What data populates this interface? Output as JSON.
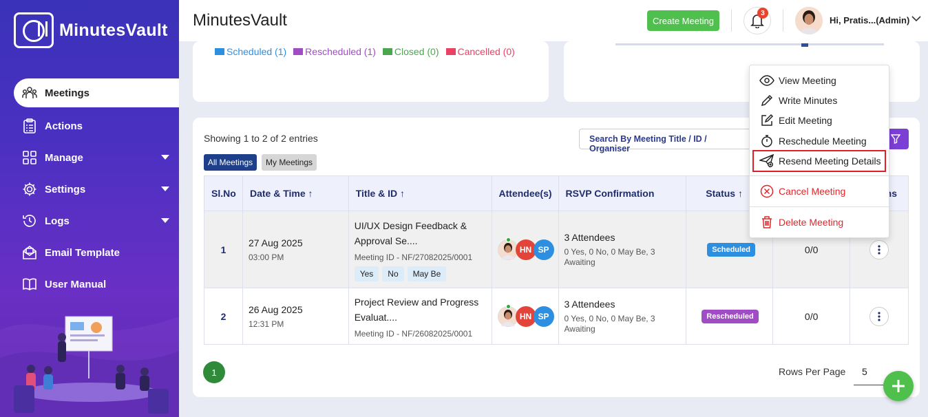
{
  "app": {
    "name": "MinutesVault"
  },
  "sidebar": {
    "items": [
      {
        "label": "Meetings",
        "icon": "meetings-icon",
        "active": true
      },
      {
        "label": "Actions",
        "icon": "clipboard-icon"
      },
      {
        "label": "Manage",
        "icon": "grid-icon",
        "caret": true
      },
      {
        "label": "Settings",
        "icon": "gear-icon",
        "caret": true
      },
      {
        "label": "Logs",
        "icon": "history-icon",
        "caret": true
      },
      {
        "label": "Email Template",
        "icon": "email-icon"
      },
      {
        "label": "User Manual",
        "icon": "book-icon"
      }
    ]
  },
  "header": {
    "title": "MinutesVault",
    "create_label": "Create Meeting",
    "notification_count": "3",
    "user_label": "Hi, Pratis...(Admin)"
  },
  "legend": [
    {
      "label": "Scheduled (1)",
      "color": "#2e8fe0"
    },
    {
      "label": "Rescheduled (1)",
      "color": "#a04cc4"
    },
    {
      "label": "Closed (0)",
      "color": "#4ca650"
    },
    {
      "label": "Cancelled (0)",
      "color": "#e94263"
    }
  ],
  "table": {
    "showing": "Showing 1 to 2 of 2 entries",
    "tab_all": "All Meetings",
    "tab_my": "My Meetings",
    "search_placeholder": "Search By Meeting Title / ID / Organiser",
    "headers": [
      "Sl.No",
      "Date & Time",
      "Title & ID",
      "Attendee(s)",
      "RSVP Confirmation",
      "Status",
      "ns"
    ],
    "rows": [
      {
        "sl": "1",
        "date": "27 Aug 2025",
        "time": "03:00 PM",
        "title": "UI/UX Design Feedback & Approval Se....",
        "meeting_id": "Meeting ID - NF/27082025/0001",
        "chips": [
          "Yes",
          "No",
          "May Be"
        ],
        "att2": "HN",
        "att3": "SP",
        "rsvp": "3 Attendees",
        "rsvp_detail": "0 Yes, 0 No, 0 May Be, 3 Awaiting",
        "status": "Scheduled",
        "ratio": "0/0"
      },
      {
        "sl": "2",
        "date": "26 Aug 2025",
        "time": "12:31 PM",
        "title": "Project Review and Progress Evaluat....",
        "meeting_id": "Meeting ID - NF/26082025/0001",
        "att2": "HN",
        "att3": "SP",
        "rsvp": "3 Attendees",
        "rsvp_detail": "0 Yes, 0 No, 0 May Be, 3 Awaiting",
        "status": "Rescheduled",
        "ratio": "0/0"
      }
    ]
  },
  "pagination": {
    "page": "1",
    "rows_label": "Rows Per Page",
    "rows_value": "5"
  },
  "menu": {
    "items": [
      {
        "label": "View Meeting",
        "icon": "eye-icon"
      },
      {
        "label": "Write Minutes",
        "icon": "pencil-icon"
      },
      {
        "label": "Edit Meeting",
        "icon": "edit-icon"
      },
      {
        "label": "Reschedule Meeting",
        "icon": "stopwatch-icon"
      },
      {
        "label": "Resend Meeting Details",
        "icon": "send-icon",
        "highlighted": true
      },
      {
        "label": "Cancel Meeting",
        "icon": "cancel-icon",
        "danger": true
      },
      {
        "label": "Delete Meeting",
        "icon": "trash-icon",
        "danger": true
      }
    ]
  }
}
